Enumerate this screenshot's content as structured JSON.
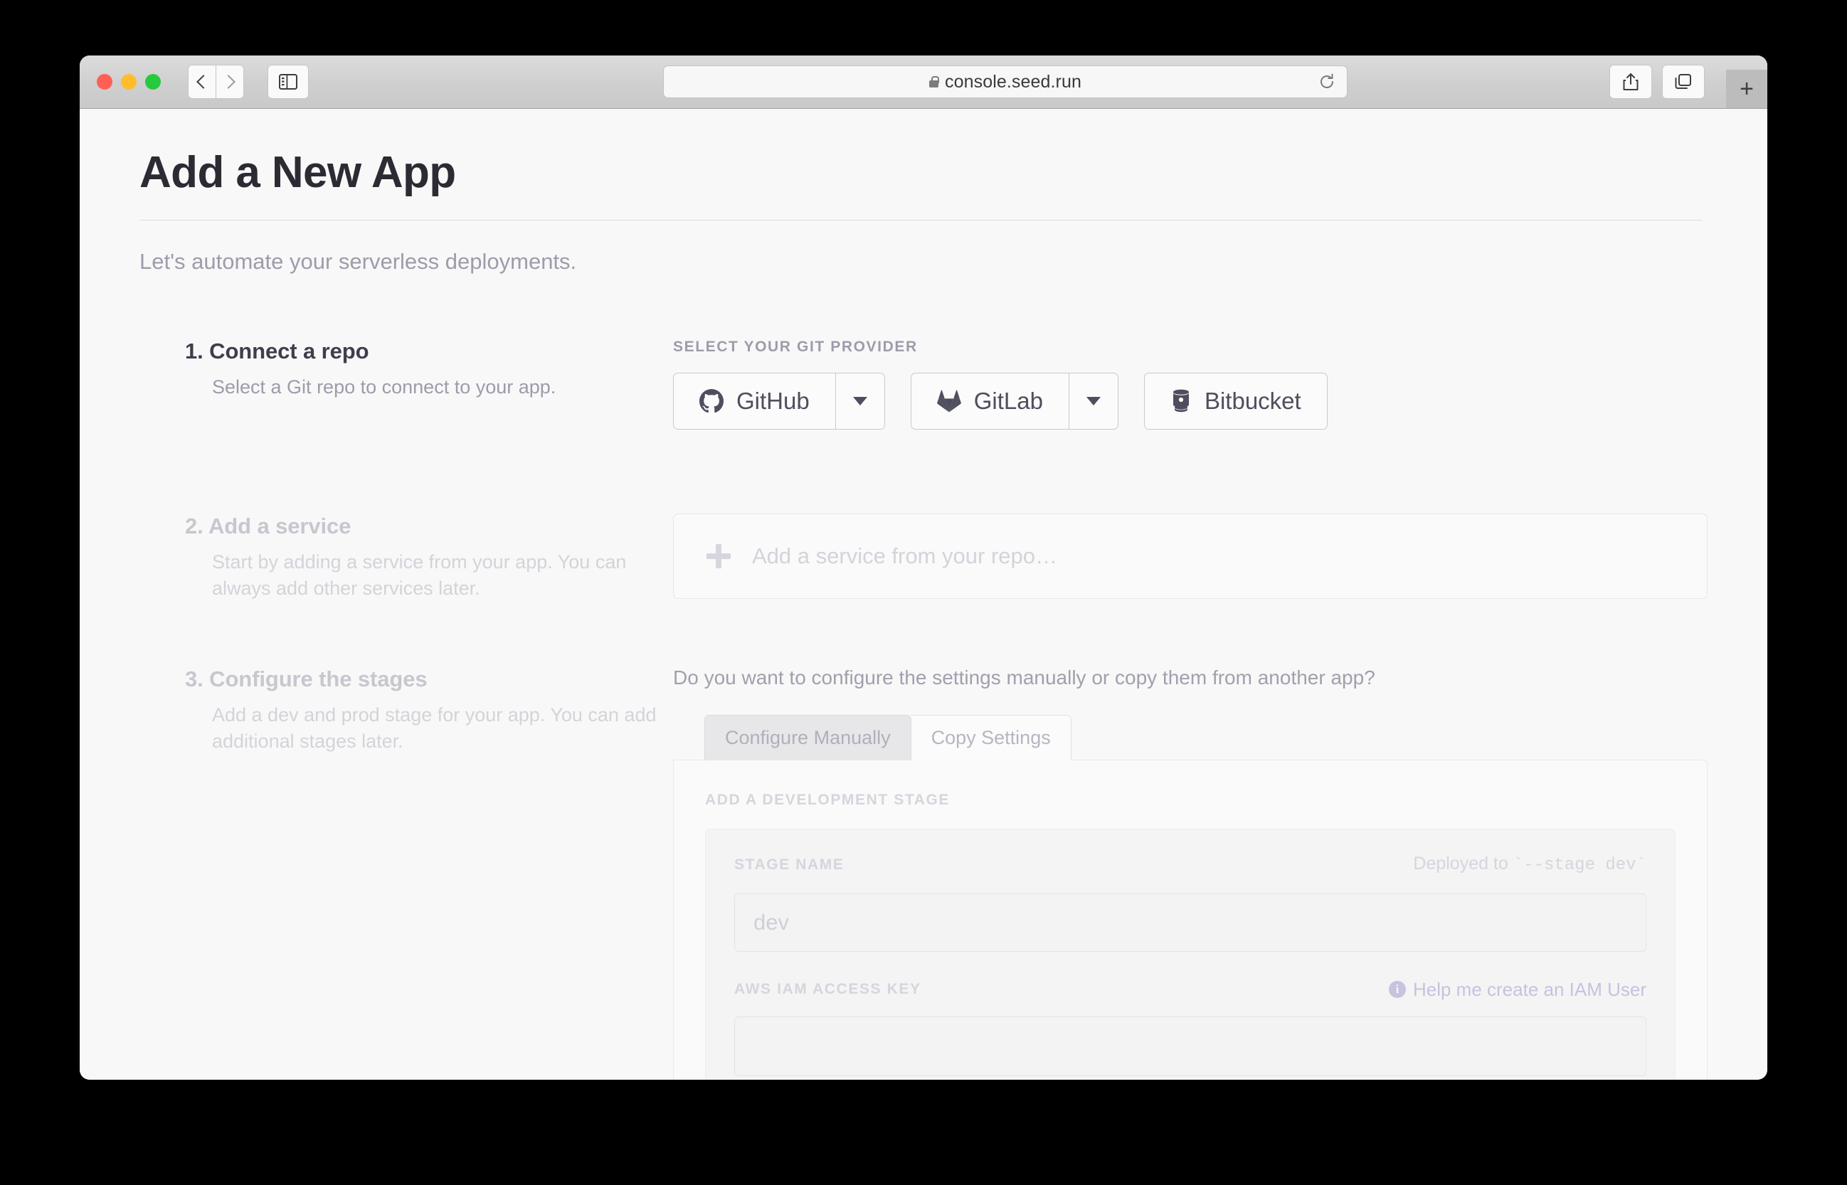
{
  "browser": {
    "url": "console.seed.run",
    "lock_icon": "lock-icon",
    "back_icon": "chevron-left-icon",
    "forward_icon": "chevron-right-icon",
    "sidebar_icon": "sidebar-toggle-icon",
    "reload_icon": "reload-icon",
    "share_icon": "share-icon",
    "tabs_overview_icon": "tabs-overview-icon",
    "new_tab_label": "+"
  },
  "page": {
    "title": "Add a New App",
    "subtitle": "Let's automate your serverless deployments."
  },
  "steps": [
    {
      "title": "1. Connect a repo",
      "desc": "Select a Git repo to connect to your app.",
      "dim": false
    },
    {
      "title": "2. Add a service",
      "desc": "Start by adding a service from your app. You can always add other services later.",
      "dim": true
    },
    {
      "title": "3. Configure the stages",
      "desc": "Add a dev and prod stage for your app. You can add additional stages later.",
      "dim": true
    }
  ],
  "git_provider": {
    "label": "SELECT YOUR GIT PROVIDER",
    "options": [
      {
        "name": "GitHub",
        "icon": "github-icon",
        "has_caret": true
      },
      {
        "name": "GitLab",
        "icon": "gitlab-icon",
        "has_caret": true
      },
      {
        "name": "Bitbucket",
        "icon": "bitbucket-icon",
        "has_caret": false
      }
    ]
  },
  "service": {
    "placeholder": "Add a service from your repo…",
    "plus_icon": "plus-icon"
  },
  "stages": {
    "question": "Do you want to configure the settings manually or copy them from another app?",
    "tabs": [
      {
        "label": "Configure Manually",
        "active": true
      },
      {
        "label": "Copy Settings",
        "active": false
      }
    ],
    "section_label": "ADD A DEVELOPMENT STAGE",
    "stage_name_label": "STAGE NAME",
    "deployed_prefix": "Deployed to ",
    "deployed_code": "`--stage dev`",
    "stage_name_placeholder": "dev",
    "iam_label": "AWS IAM ACCESS KEY",
    "iam_help_text": "Help me create an IAM User",
    "iam_help_icon": "info-icon"
  },
  "colors": {
    "accent_link": "#c5c3dd",
    "heading": "#2b2b33",
    "muted": "#9c9cab",
    "dim": "#d3d3da",
    "page_bg": "#f8f8f8"
  }
}
